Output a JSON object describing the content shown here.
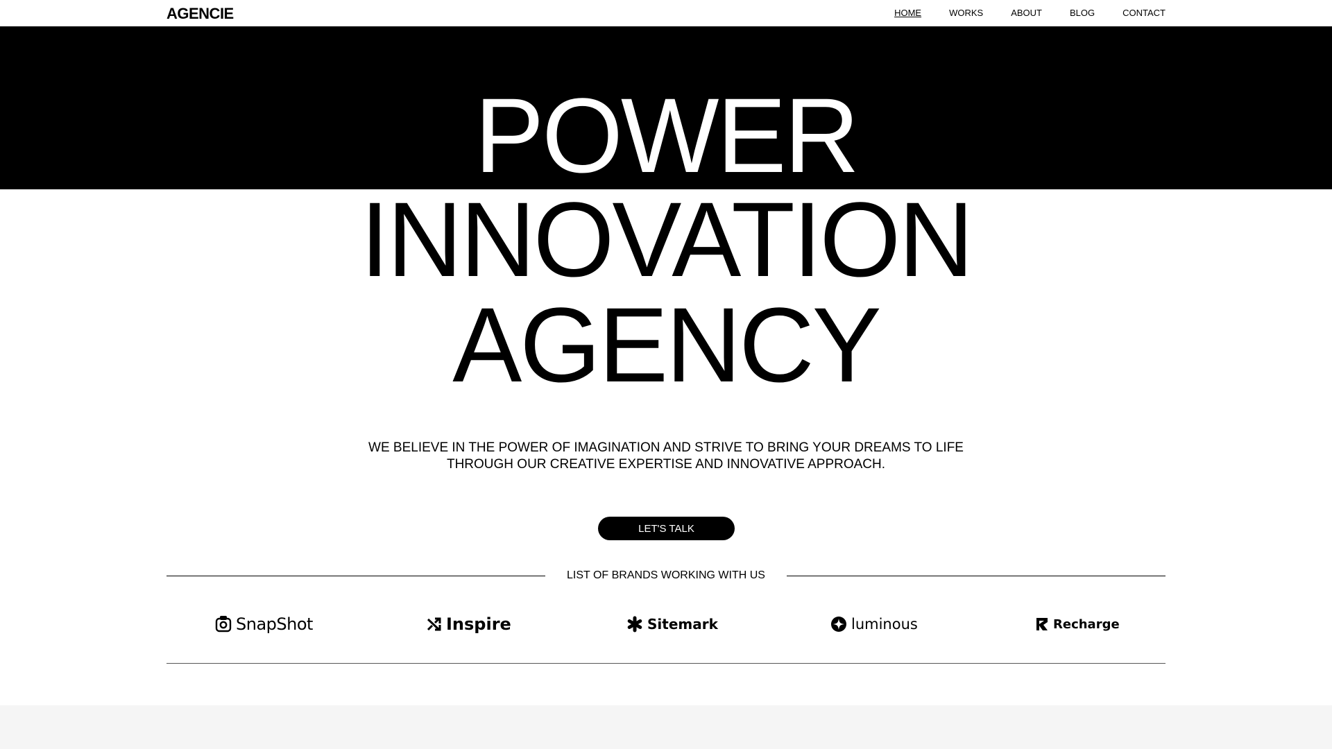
{
  "header": {
    "logo": "AGENCIE",
    "nav": [
      {
        "label": "HOME",
        "active": true
      },
      {
        "label": "WORKS",
        "active": false
      },
      {
        "label": "ABOUT",
        "active": false
      },
      {
        "label": "BLOG",
        "active": false
      },
      {
        "label": "CONTACT",
        "active": false
      }
    ]
  },
  "hero": {
    "line1": "POWER",
    "line2": "INNOVATION",
    "line3": "AGENCY",
    "tagline_line1": "WE BELIEVE IN THE POWER OF IMAGINATION AND STRIVE TO BRING YOUR DREAMS TO LIFE",
    "tagline_line2": "THROUGH OUR CREATIVE EXPERTISE AND INNOVATIVE APPROACH.",
    "cta_label": "LET'S TALK"
  },
  "brands": {
    "title": "LIST OF BRANDS WORKING WITH US",
    "items": [
      {
        "name": "SnapShot",
        "icon": "snapshot-logo-icon"
      },
      {
        "name": "Inspire",
        "icon": "shuffle-icon"
      },
      {
        "name": "Sitemark",
        "icon": "asterisk-icon"
      },
      {
        "name": "luminous",
        "icon": "star-circle-icon"
      },
      {
        "name": "Recharge",
        "icon": "recharge-logo-icon"
      }
    ]
  },
  "colors": {
    "background": "#ffffff",
    "text": "#000000",
    "band": "#000000",
    "footer_band": "#f5f5f5"
  }
}
